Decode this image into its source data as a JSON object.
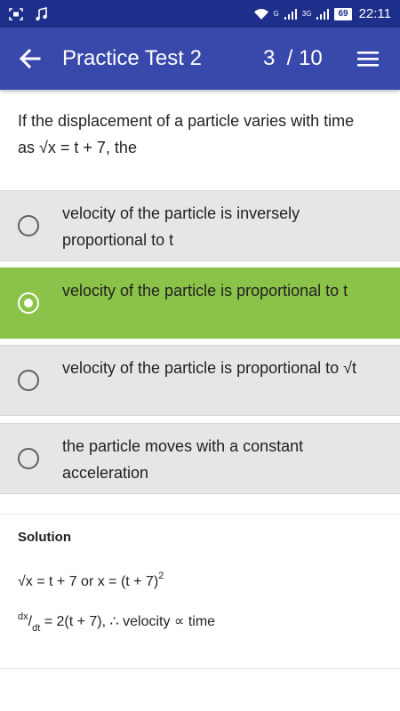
{
  "status_bar": {
    "network_label": "G",
    "network_label_2": "3G",
    "battery": "69",
    "time": "22:11",
    "icons": [
      "screenshot-icon",
      "music-icon",
      "wifi-icon",
      "signal-icon",
      "battery-icon"
    ]
  },
  "app_bar": {
    "title": "Practice Test 2",
    "progress": "3  / 10",
    "back_icon": "arrow-back-icon",
    "menu_icon": "menu-icon"
  },
  "question": {
    "text": "If the displacement of a particle varies with time as √x = t + 7, the"
  },
  "options": [
    {
      "text": "velocity of the particle is inversely proportional to t",
      "selected": false
    },
    {
      "text": "velocity of the particle is proportional to t",
      "selected": true
    },
    {
      "text": "velocity of the particle is proportional to √t",
      "selected": false
    },
    {
      "text": "the particle moves with a constant acceleration",
      "selected": false
    }
  ],
  "solution": {
    "title": "Solution",
    "line1_text": "√x = t + 7 or x = (t + 7)",
    "line1_exponent": "2",
    "line2_numerator": "dx",
    "line2_slash": "/",
    "line2_denominator": "dt",
    "line2_rest": " = 2(t + 7), ∴ velocity ∝ time"
  },
  "colors": {
    "status_bar": "#1d2f8a",
    "app_bar": "#3949ab",
    "option_default": "#e6e6e6",
    "option_selected": "#8bc34a"
  }
}
